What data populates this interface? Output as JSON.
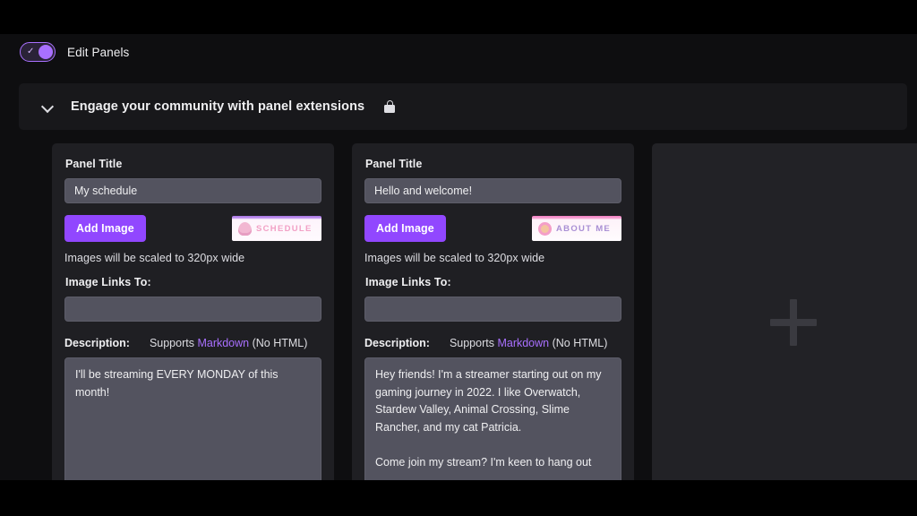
{
  "toggle": {
    "label": "Edit Panels",
    "checked": true,
    "check_glyph": "✓",
    "accent_color": "#a970ff"
  },
  "section": {
    "title": "Engage your community with panel extensions",
    "chevron_icon": "chevron-down-icon",
    "lock_icon": "lock-icon",
    "expanded": true
  },
  "panels": [
    {
      "title_label": "Panel Title",
      "title_value": "My schedule",
      "title_placeholder": "Panel Title",
      "add_image_label": "Add Image",
      "thumbnail": {
        "text": "SCHEDULE",
        "icon": "cake-icon",
        "text_color": "#f2a1c6",
        "background": "#fffafe"
      },
      "image_hint": "Images will be scaled to 320px wide",
      "link_label": "Image Links To:",
      "link_value": "",
      "link_placeholder": "",
      "description_label": "Description:",
      "description_hint_prefix": "Supports ",
      "description_hint_link": "Markdown",
      "description_hint_suffix": " (No HTML)",
      "description_value": "I'll be streaming EVERY MONDAY of this month!"
    },
    {
      "title_label": "Panel Title",
      "title_value": "Hello and welcome!",
      "title_placeholder": "Panel Title",
      "add_image_label": "Add Image",
      "thumbnail": {
        "text": "ABOUT  ME",
        "icon": "donut-icon",
        "text_color": "#a98fd4",
        "background": "#fffcfe"
      },
      "image_hint": "Images will be scaled to 320px wide",
      "link_label": "Image Links To:",
      "link_value": "",
      "link_placeholder": "",
      "description_label": "Description:",
      "description_hint_prefix": "Supports ",
      "description_hint_link": "Markdown",
      "description_hint_suffix": " (No HTML)",
      "description_value": "Hey friends! I'm a streamer starting out on my gaming journey in 2022. I like Overwatch, Stardew Valley, Animal Crossing, Slime Rancher, and my cat Patricia.\n\nCome join my stream? I'm keen to hang out"
    }
  ],
  "add_panel": {
    "icon": "plus-icon",
    "label": ""
  },
  "colors": {
    "page_background": "#0e0e10",
    "card_background": "#1f1f23",
    "input_background": "#53535f",
    "accent_purple": "#9147ff",
    "link_purple": "#a970ff",
    "text_primary": "#efeff1"
  }
}
